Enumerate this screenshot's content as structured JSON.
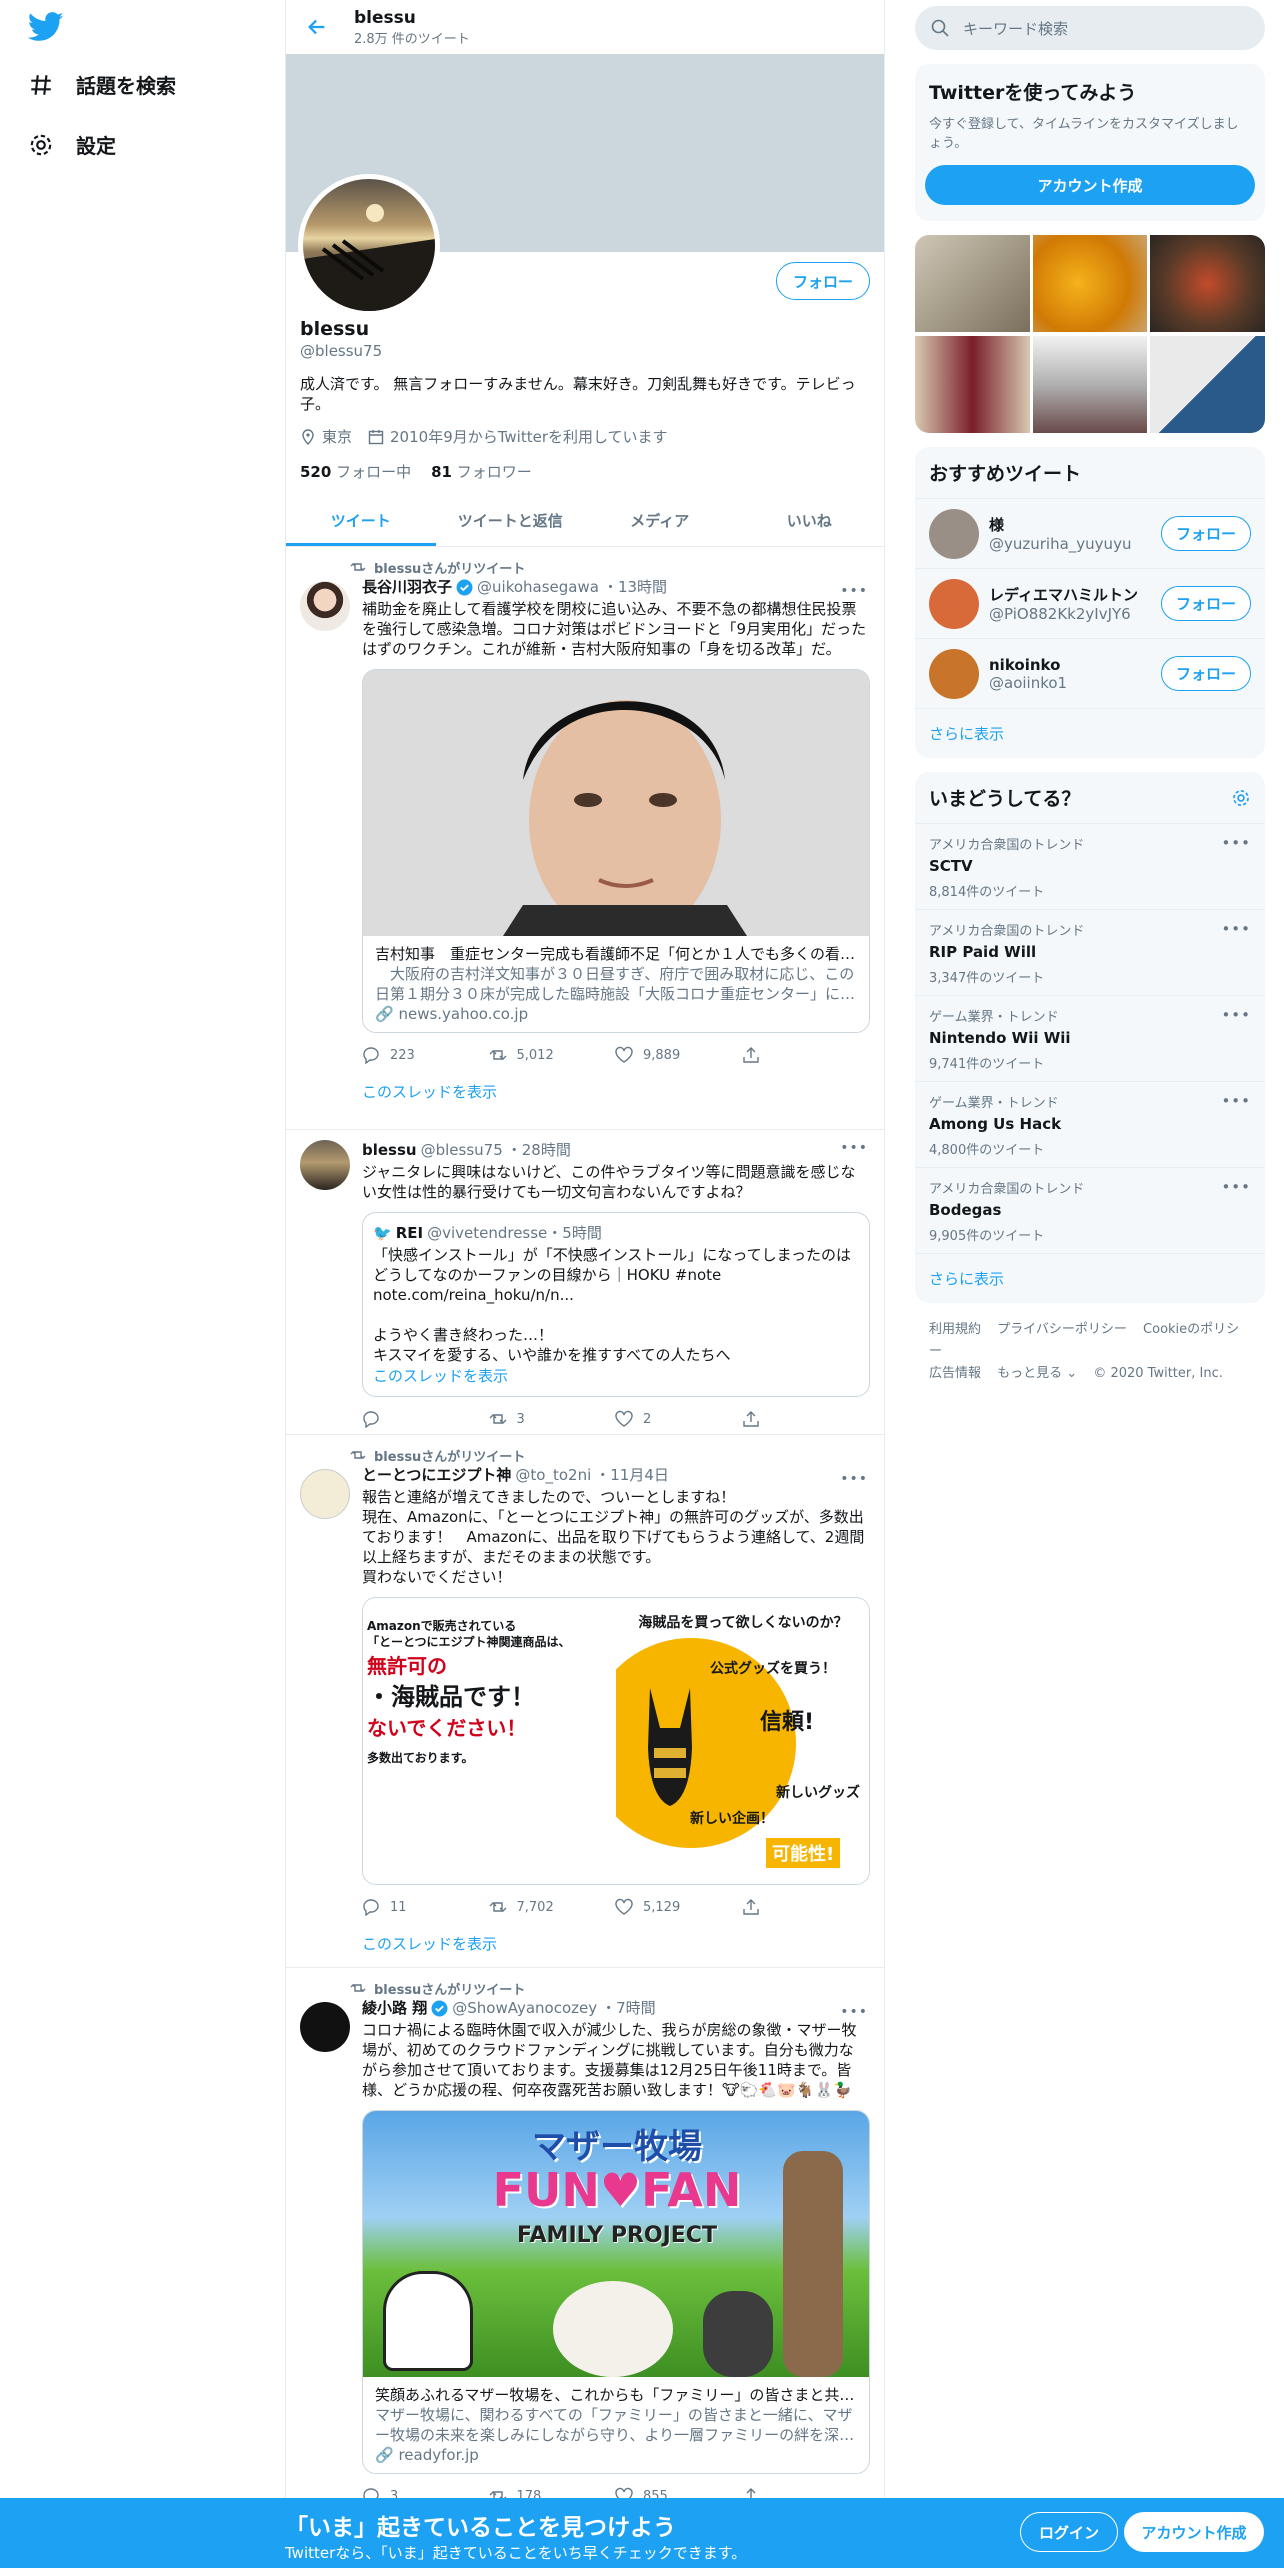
{
  "nav": {
    "explore": "話題を検索",
    "settings": "設定"
  },
  "header": {
    "name": "blessu",
    "tweets_count": "2.8万 件のツイート"
  },
  "profile": {
    "follow": "フォロー",
    "name": "blessu",
    "handle": "@blessu75",
    "bio_line1": "成人済です。 無言フォローすみません。幕末好き。刀剣乱舞も好きです。テレビっ",
    "bio_line2": "子。",
    "location": "東京",
    "joined": "2010年9月からTwitterを利用しています",
    "following_count": "520",
    "following_label": "フォロー中",
    "followers_count": "81",
    "followers_label": "フォロワー"
  },
  "tabs": [
    "ツイート",
    "ツイートと返信",
    "メディア",
    "いいね"
  ],
  "tweets": [
    {
      "rt": "blessuさんがリツイート",
      "name": "長谷川羽衣子",
      "handle": "@uikohasegawa",
      "time": "・13時間",
      "text1": "補助金を廃止して看護学校を閉校に追い込み、不要不急の都構想住民投票",
      "text2": "を強行して感染急増。コロナ対策はポビドンヨードと「9月実用化」だった",
      "text3": "はずのワクチン。これが維新・吉村大阪府知事の「身を切る改革」だ。",
      "card_title": "吉村知事　重症センター完成も看護師不足「何とか１人でも多くの看…",
      "card_desc1": "　大阪府の吉村洋文知事が３０日昼すぎ、府庁で囲み取材に応じ、この",
      "card_desc2": "日第１期分３０床が完成した臨時施設「大阪コロナ重症センター」に…",
      "card_url": "news.yahoo.co.jp",
      "reply": "223",
      "retweet": "5,012",
      "like": "9,889",
      "thread": "このスレッドを表示"
    },
    {
      "name": "blessu",
      "handle": "@blessu75",
      "time": "・28時間",
      "text1": "ジャニタレに興味はないけど、この件やラブタイツ等に問題意識を感じな",
      "text2": "い女性は性的暴行受けても一切文句言わないんですよね？",
      "q_name": "REI",
      "q_handle": "@vivetendresse・5時間",
      "q_text1": "「快感インストール」が「不快感インストール」になってしまったのは",
      "q_text2": "どうしてなのかーファンの目線から｜HOKU #note",
      "q_text3": "note.com/reina_hoku/n/n...",
      "q_text4": "ようやく書き終わった…！",
      "q_text5": "キスマイを愛する、いや誰かを推すすべての人たちへ",
      "q_thread": "このスレッドを表示",
      "reply": "",
      "retweet": "3",
      "like": "2"
    },
    {
      "rt": "blessuさんがリツイート",
      "name": "とーとつにエジプト神",
      "handle": "@to_to2ni",
      "time": "・11月4日",
      "text1": "報告と連絡が増えてきましたので、ついーとしますね！",
      "text2": "現在、Amazonに、「とーとつにエジプト神」の無許可のグッズが、多数出",
      "text3": "ております！　Amazonに、出品を取り下げてもらうよう連絡して、2週間",
      "text4": "以上経ちますが、まだそのままの状態です。",
      "text5": "買わないでください！",
      "img_left1": "Amazonで販売されている",
      "img_left2": "「とーとつにエジプト神関連商品は、",
      "img_left3": "無許可の",
      "img_left4": "・海賊品です！",
      "img_left5": "ないでください！",
      "img_left6": "多数出ております。",
      "img_right1": "海賊品を買って欲しくないのか？",
      "img_right2": "公式グッズを買う！",
      "img_right3": "信頼!",
      "img_right4": "新しい企画！",
      "img_right5": "新しいグッズ",
      "img_right6": "可能性!",
      "reply": "11",
      "retweet": "7,702",
      "like": "5,129",
      "thread": "このスレッドを表示"
    },
    {
      "rt": "blessuさんがリツイート",
      "name": "綾小路 翔",
      "handle": "@ShowAyanocozey",
      "time": "・7時間",
      "text1": "コロナ禍による臨時休園で収入が減少した、我らが房総の象徴・マザー牧",
      "text2": "場が、初めてのクラウドファンディングに挑戦しています。自分も微力な",
      "text3": "がら参加させて頂いております。支援募集は12月25日午後11時まで。皆",
      "text4": "様、どうか応援の程、何卒夜露死苦お願い致します！🐮🐑🐔🐷🐐🐰🦆",
      "img_title": "マザー牧場",
      "img_fun": "FUN♥FAN",
      "img_sub": "FAMILY PROJECT",
      "card_title": "笑顔あふれるマザー牧場を、これからも「ファミリー」の皆さまと共…",
      "card_desc1": "マザー牧場に、関わるすべての「ファミリー」の皆さまと一緒に、マザ",
      "card_desc2": "ー牧場の未来を楽しみにしながら守り、より一層ファミリーの絆を深…",
      "card_url": "readyfor.jp",
      "reply": "3",
      "retweet": "178",
      "like": "855"
    }
  ],
  "sidebar": {
    "search_placeholder": "キーワード検索",
    "signup_title": "Twitterを使ってみよう",
    "signup_sub": "今すぐ登録して、タイムラインをカスタマイズしましょう。",
    "signup_btn": "アカウント作成",
    "who_title": "おすすめツイート",
    "who": [
      {
        "name": "様",
        "handle": "@yuzuriha_yuyuyu",
        "btn": "フォロー",
        "color": "#9a8f86"
      },
      {
        "name": "レディエマハミルトン",
        "handle": "@PiO882Kk2yIvJY6",
        "btn": "フォロー",
        "color": "#d86a3a"
      },
      {
        "name": "nikoinko",
        "handle": "@aoiinko1",
        "btn": "フォロー",
        "color": "#c8742a"
      }
    ],
    "show_more": "さらに表示",
    "trends_title": "いまどうしてる？",
    "trends": [
      {
        "cat": "アメリカ合衆国のトレンド",
        "name": "SCTV",
        "count": "8,814件のツイート"
      },
      {
        "cat": "アメリカ合衆国のトレンド",
        "name": "RIP Paid Will",
        "count": "3,347件のツイート"
      },
      {
        "cat": "ゲーム業界・トレンド",
        "name": "Nintendo Wii Wii",
        "count": "9,741件のツイート"
      },
      {
        "cat": "ゲーム業界・トレンド",
        "name": "Among Us Hack",
        "count": "4,800件のツイート"
      },
      {
        "cat": "アメリカ合衆国のトレンド",
        "name": "Bodegas",
        "count": "9,905件のツイート"
      }
    ],
    "trends_more": "さらに表示",
    "footer1": [
      "利用規約",
      "プライバシーポリシー",
      "Cookieのポリシー"
    ],
    "footer2": [
      "広告情報",
      "もっと見る ⌄",
      "© 2020 Twitter, Inc."
    ]
  },
  "bottom": {
    "title": "「いま」起きていることを見つけよう",
    "sub": "Twitterなら、「いま」起きていることをいち早くチェックできます。",
    "login": "ログイン",
    "signup": "アカウント作成"
  },
  "colors": {
    "accent": "#1da1f2",
    "muted": "#657786",
    "border": "#e6ecf0"
  }
}
